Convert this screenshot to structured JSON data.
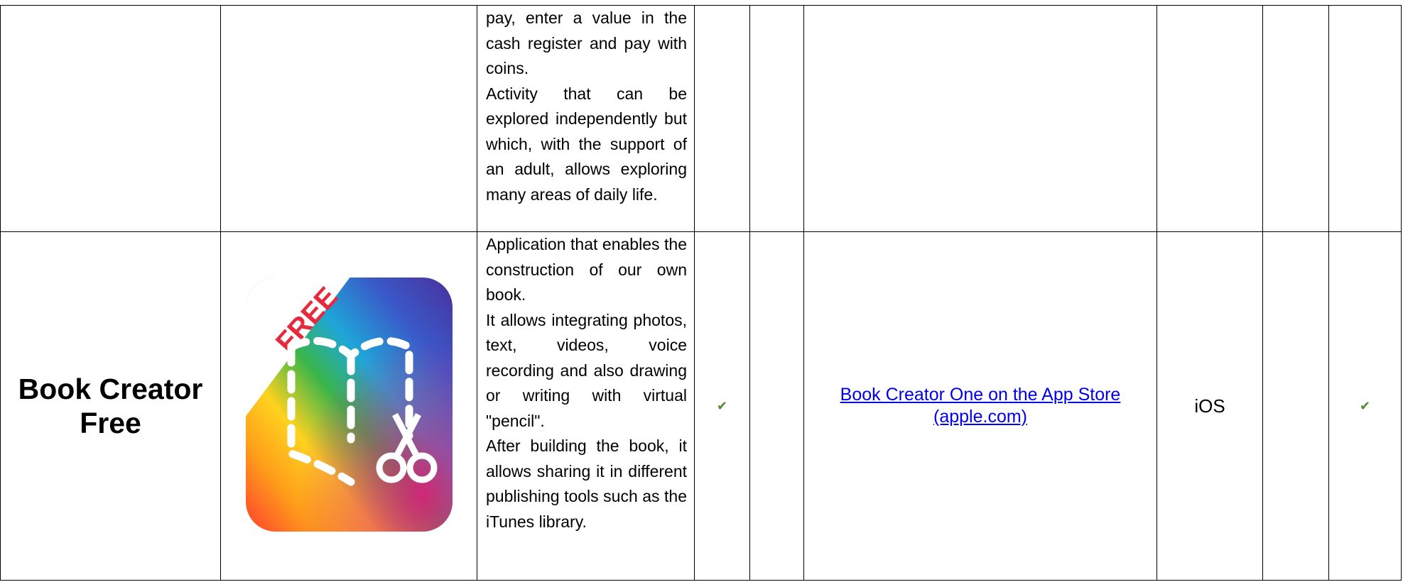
{
  "rows": [
    {
      "name": "",
      "description": [
        "pay, enter a value in the cash register and pay with coins.",
        "Activity that can be explored independently but which, with the support of an adult, allows exploring many areas of daily life."
      ]
    },
    {
      "name": "Book Creator Free",
      "icon": "book-creator-app-icon",
      "icon_badge": "FREE",
      "description": [
        "Application that enables the construction of our own book.",
        "It allows integrating photos, text, videos, voice recording and also drawing or writing with virtual \"pencil\".",
        "After building the book, it allows sharing it in different publishing tools such as the iTunes library."
      ],
      "check_1": "✔",
      "link_text": "Book Creator One on the App Store (apple.com)",
      "platform": "iOS",
      "check_2": "✔"
    }
  ],
  "colors": {
    "check": "#4f8a2e",
    "link": "#0000ee"
  }
}
